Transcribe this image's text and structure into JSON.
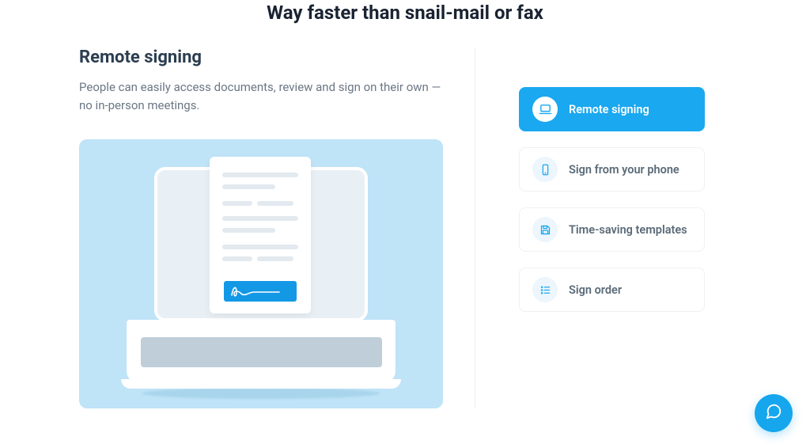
{
  "header": {
    "title": "Way faster than snail-mail or fax"
  },
  "feature": {
    "title": "Remote signing",
    "description": "People can easily access documents, review and sign on their own — no in-person meetings."
  },
  "options": [
    {
      "label": "Remote signing",
      "active": true,
      "icon": "laptop-icon"
    },
    {
      "label": "Sign from your phone",
      "active": false,
      "icon": "phone-icon"
    },
    {
      "label": "Time-saving templates",
      "active": false,
      "icon": "floppy-icon"
    },
    {
      "label": "Sign order",
      "active": false,
      "icon": "list-icon"
    }
  ],
  "chat": {
    "aria": "Open chat"
  },
  "colors": {
    "accent": "#1aa8f0",
    "illustration_bg": "#bfe3f7"
  }
}
